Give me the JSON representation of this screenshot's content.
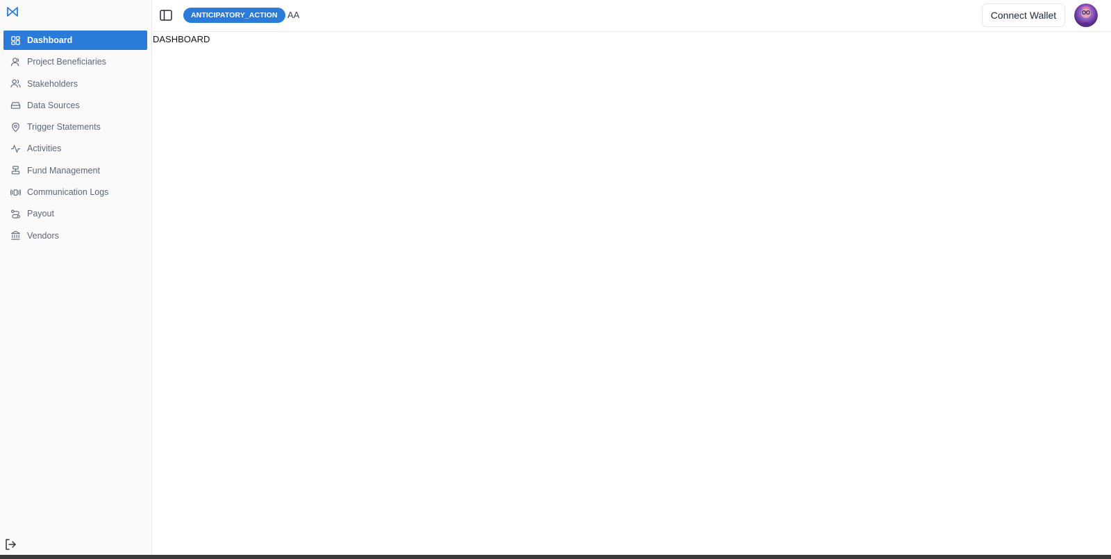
{
  "sidebar": {
    "items": [
      {
        "label": "Dashboard",
        "icon": "grid-icon",
        "active": true
      },
      {
        "label": "Project Beneficiaries",
        "icon": "user-icon"
      },
      {
        "label": "Stakeholders",
        "icon": "users-icon"
      },
      {
        "label": "Data Sources",
        "icon": "hard-drive-icon"
      },
      {
        "label": "Trigger Statements",
        "icon": "shield-icon"
      },
      {
        "label": "Activities",
        "icon": "activity-icon"
      },
      {
        "label": "Fund Management",
        "icon": "align-center-icon"
      },
      {
        "label": "Communication Logs",
        "icon": "broadcast-icon"
      },
      {
        "label": "Payout",
        "icon": "route-icon"
      },
      {
        "label": "Vendors",
        "icon": "landmark-icon"
      }
    ]
  },
  "header": {
    "badge": "ANTICIPATORY_ACTION",
    "project_code": "AA",
    "connect_label": "Connect Wallet"
  },
  "main": {
    "title": "DASHBOARD"
  },
  "colors": {
    "accent": "#2b7bd9",
    "sidebar_bg": "#fafafa",
    "nav_text": "#5c6779"
  }
}
